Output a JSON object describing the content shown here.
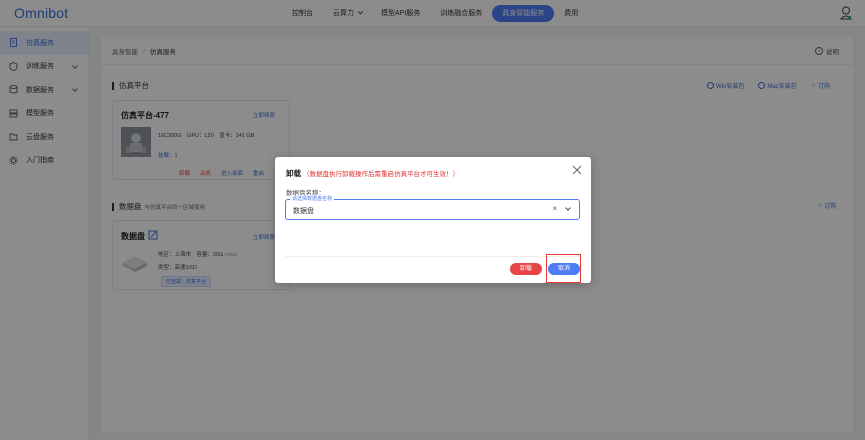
{
  "app": {
    "logo": "Omnibot"
  },
  "topnav": {
    "items": [
      {
        "label": "控制台",
        "has_caret": false,
        "active": false
      },
      {
        "label": "云算力",
        "has_caret": true,
        "active": false
      },
      {
        "label": "模型API服务",
        "has_caret": false,
        "active": false
      },
      {
        "label": "训练融合服务",
        "has_caret": false,
        "active": false
      },
      {
        "label": "具身智能服务",
        "has_caret": false,
        "active": true
      },
      {
        "label": "费用",
        "has_caret": false,
        "active": false
      }
    ]
  },
  "sidebar": {
    "items": [
      {
        "label": "仿真服务",
        "icon": "document-icon",
        "active": true,
        "expandable": false
      },
      {
        "label": "训练服务",
        "icon": "shield-icon",
        "active": false,
        "expandable": true
      },
      {
        "label": "数据服务",
        "icon": "database-icon",
        "active": false,
        "expandable": true
      },
      {
        "label": "模型服务",
        "icon": "server-icon",
        "active": false,
        "expandable": false
      },
      {
        "label": "云盘服务",
        "icon": "folder-icon",
        "active": false,
        "expandable": false
      },
      {
        "label": "入门指南",
        "icon": "gear-icon",
        "active": false,
        "expandable": false
      }
    ]
  },
  "main": {
    "breadcrumb": {
      "root": "具身智能",
      "sep": "/",
      "current": "仿真服务"
    },
    "help": "说明",
    "sim_section": {
      "title": "仿真平台",
      "links": [
        "Win安装包",
        "Mac安装包",
        "订购"
      ]
    },
    "sim_card": {
      "title": "仿真平台-477",
      "renew": "立即续费",
      "spec": "16C200G　GPU：L20　显卡：141 GB",
      "mounted": "挂载：1",
      "actions": [
        "卸载",
        "关机",
        "进入桌面",
        "重启"
      ]
    },
    "disk_section": {
      "title": "数据盘",
      "subtitle": "与仿真平台同一区域使用",
      "links": [
        "订购"
      ]
    },
    "disk_card": {
      "title": "数据盘",
      "renew": "立即续费",
      "region": "地区：上海市　容量：20G",
      "region_extra": "+200G",
      "type": "类型：高速SSD",
      "tag": "已挂载：仿真平台"
    }
  },
  "modal": {
    "title": "卸载",
    "warning": "（数据盘执行卸载操作后需重启仿真平台才可生效！）",
    "field_label": "数据盘名称：",
    "select_legend": "请选择数据盘名称",
    "select_value": "数据盘",
    "clear": "×",
    "unmount_button": "卸载",
    "cancel_button": "取消"
  },
  "colors": {
    "accent": "#4d7cf6",
    "danger": "#e64545",
    "warning_text": "#e0302e"
  }
}
